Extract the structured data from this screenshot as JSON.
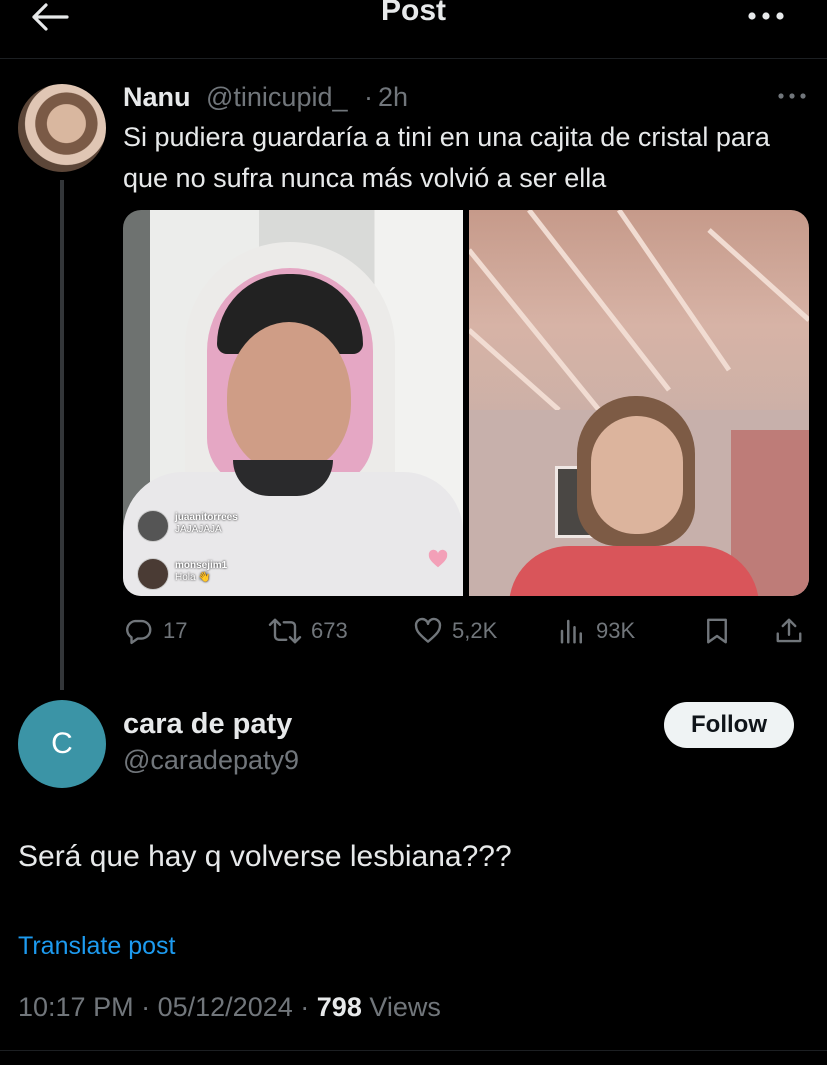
{
  "header": {
    "title": "Post"
  },
  "parent_tweet": {
    "name": "Nanu",
    "handle": "@tinicupid_",
    "dot": "·",
    "time": "2h",
    "text": "Si pudiera guardaría a tini en una cajita de cristal para que no sufra nunca más volvió a ser ella",
    "media_overlay": {
      "comment1_user": "juaanitorrees",
      "comment1_text": "JAJAJAJA",
      "comment2_user": "monsejim1",
      "comment2_text": "Hola 👋"
    },
    "stats": {
      "replies": "17",
      "reposts": "673",
      "likes": "5,2K",
      "views": "93K"
    }
  },
  "reply_tweet": {
    "avatar_letter": "C",
    "name": "cara de paty",
    "handle": "@caradepaty9",
    "follow_label": "Follow",
    "text": "Será que hay q volverse lesbiana???",
    "translate_label": "Translate post",
    "time": "10:17 PM",
    "date": "05/12/2024",
    "views_count": "798",
    "views_label": "Views",
    "sep": "·"
  },
  "colors": {
    "background": "#000000",
    "text_primary": "#e7e9ea",
    "text_secondary": "#71767b",
    "link": "#1d9bf0",
    "avatar_bg": "#3b94a6"
  },
  "icons": [
    "back-arrow-icon",
    "more-icon",
    "reply-icon",
    "repost-icon",
    "like-icon",
    "views-icon",
    "bookmark-icon",
    "share-icon"
  ]
}
